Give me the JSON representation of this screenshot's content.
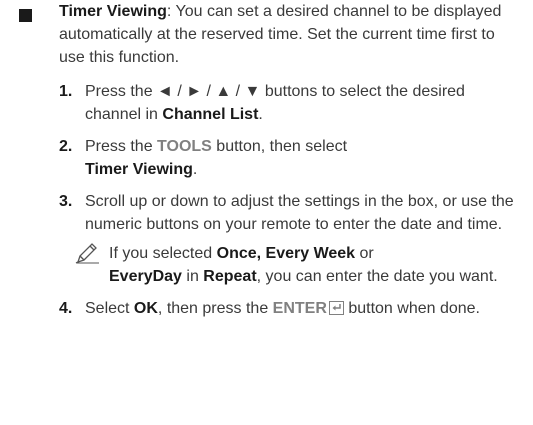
{
  "intro": {
    "term": "Timer Viewing",
    "text": ": You can set a desired channel to be displayed automatically at the reserved time. Set the current time first to use this function."
  },
  "steps": [
    {
      "num": "1.",
      "pre": "Press the ◄ / ► / ▲ / ▼ buttons to select the desired channel in ",
      "b1": "Channel List",
      "post": "."
    },
    {
      "num": "2.",
      "pre": "Press the ",
      "key": "TOOLS",
      "mid": " button, then select ",
      "b1": "Timer Viewing",
      "post": "."
    },
    {
      "num": "3.",
      "text": "Scroll up or down to adjust the settings in the box, or use the numeric buttons on your remote to enter the date and time."
    },
    {
      "num": "4.",
      "pre": "Select ",
      "b1": "OK",
      "mid": ", then press the ",
      "key": "ENTER",
      "post": " button when done."
    }
  ],
  "note": {
    "pre": "If you selected ",
    "b1": "Once, Every Week",
    "mid1": " or ",
    "b2": "EveryDay",
    "mid2": " in ",
    "b3": "Repeat",
    "post": ", you can enter the date you want."
  },
  "icons": {
    "bullet": "square-bullet-icon",
    "note": "pencil-note-icon",
    "enter": "enter-key-icon"
  }
}
